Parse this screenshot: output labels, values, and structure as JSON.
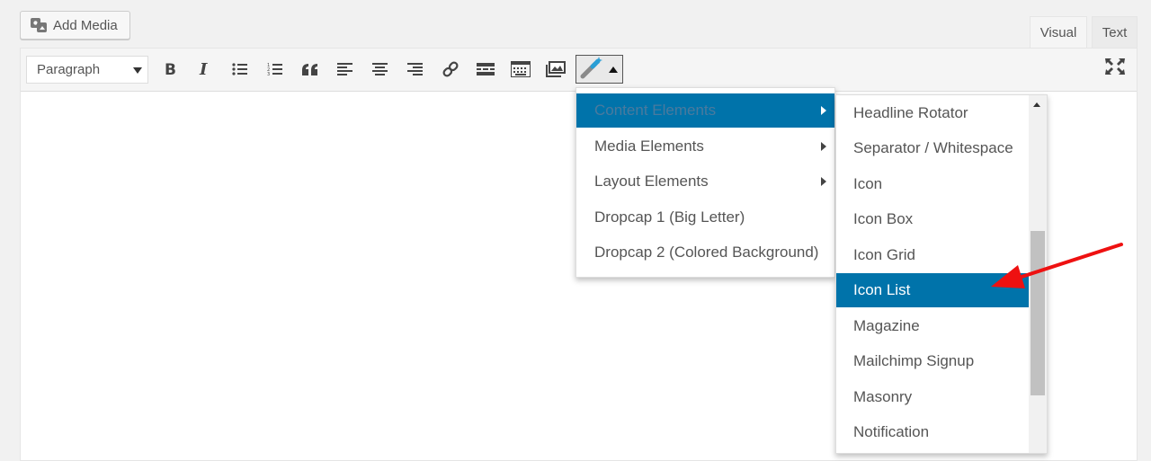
{
  "toolbar_top": {
    "add_media_label": "Add Media"
  },
  "tabs": {
    "visual": "Visual",
    "text": "Text"
  },
  "editor": {
    "format_select": {
      "value": "Paragraph"
    },
    "buttons": [
      {
        "name": "bold-icon"
      },
      {
        "name": "italic-icon"
      },
      {
        "name": "bulleted-list-icon"
      },
      {
        "name": "numbered-list-icon"
      },
      {
        "name": "blockquote-icon"
      },
      {
        "name": "align-left-icon"
      },
      {
        "name": "align-center-icon"
      },
      {
        "name": "align-right-icon"
      },
      {
        "name": "insert-link-icon"
      },
      {
        "name": "read-more-icon"
      },
      {
        "name": "toolbar-toggle-icon"
      },
      {
        "name": "gallery-icon"
      },
      {
        "name": "shortcode-wand-icon"
      },
      {
        "name": "fullscreen-icon"
      }
    ]
  },
  "menu_primary": {
    "items": [
      {
        "label": "Content Elements",
        "has_submenu": true,
        "active": true
      },
      {
        "label": "Media Elements",
        "has_submenu": true
      },
      {
        "label": "Layout Elements",
        "has_submenu": true
      },
      {
        "label": "Dropcap 1 (Big Letter)"
      },
      {
        "label": "Dropcap 2 (Colored Background)"
      }
    ]
  },
  "menu_content_elements": {
    "items": [
      {
        "label": "Headline Rotator"
      },
      {
        "label": "Separator / Whitespace"
      },
      {
        "label": "Icon"
      },
      {
        "label": "Icon Box"
      },
      {
        "label": "Icon Grid"
      },
      {
        "label": "Icon List",
        "active": true
      },
      {
        "label": "Magazine"
      },
      {
        "label": "Mailchimp Signup"
      },
      {
        "label": "Masonry"
      },
      {
        "label": "Notification"
      }
    ]
  },
  "colors": {
    "accent": "#0073aa",
    "annotation_arrow": "#ee1111"
  }
}
